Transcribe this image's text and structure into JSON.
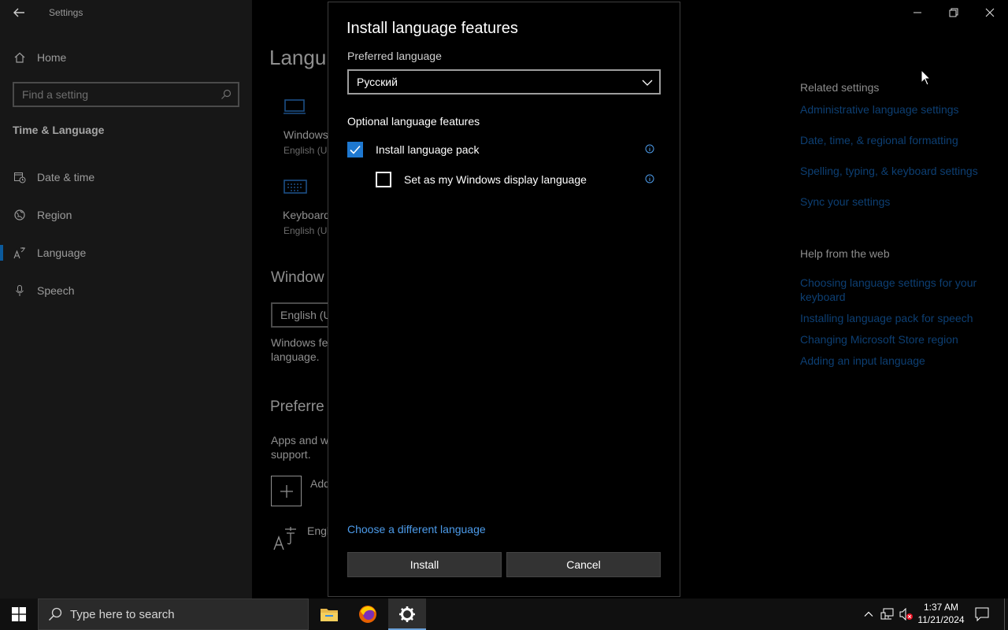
{
  "window": {
    "title": "Settings"
  },
  "sidebar": {
    "home_label": "Home",
    "search_placeholder": "Find a setting",
    "section_heading": "Time & Language",
    "items": [
      {
        "label": "Date & time",
        "icon": "calendar-clock-icon"
      },
      {
        "label": "Region",
        "icon": "globe-icon"
      },
      {
        "label": "Language",
        "icon": "language-icon",
        "active": true
      },
      {
        "label": "Speech",
        "icon": "microphone-icon"
      }
    ]
  },
  "main": {
    "heading_partial": "Langu",
    "windows_display_label": "Windows",
    "windows_display_sub": "English (U",
    "keyboard_label": "Keyboard",
    "keyboard_sub": "English (U",
    "windows_display_lang_heading": "Window",
    "windows_lang_value": "English (U",
    "windows_features_line1": "Windows fe",
    "windows_features_line2": "language.",
    "preferred_heading": "Preferre",
    "apps_line1": "Apps and w",
    "apps_line2": "support.",
    "add_label": "Add",
    "english_label": "Engl"
  },
  "related": {
    "heading": "Related settings",
    "links": [
      "Administrative language settings",
      "Date, time, & regional formatting",
      "Spelling, typing, & keyboard settings",
      "Sync your settings"
    ]
  },
  "help": {
    "heading": "Help from the web",
    "links": [
      "Choosing language settings for your keyboard",
      "Installing language pack for speech",
      "Changing Microsoft Store region",
      "Adding an input language"
    ]
  },
  "dialog": {
    "title": "Install language features",
    "preferred_label": "Preferred language",
    "preferred_value": "Русский",
    "optional_label": "Optional language features",
    "option_pack": {
      "label": "Install language pack",
      "checked": true
    },
    "option_display": {
      "label": "Set as my Windows display language",
      "checked": false
    },
    "choose_link": "Choose a different language",
    "install_button": "Install",
    "cancel_button": "Cancel"
  },
  "taskbar": {
    "search_placeholder": "Type here to search",
    "time": "1:37 AM",
    "date": "11/21/2024"
  },
  "colors": {
    "accent": "#1e78d0",
    "link": "#4c9bea",
    "background": "#000000"
  }
}
